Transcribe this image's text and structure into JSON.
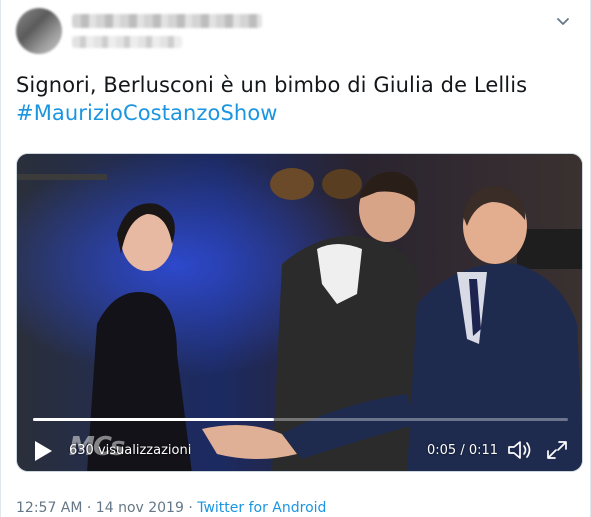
{
  "tweet": {
    "line1": "Signori, Berlusconi è un bimbo di Giulia de Lellis",
    "hashtag": "#MaurizioCostanzoShow"
  },
  "video": {
    "views_label": "630 visualizzazioni",
    "time_label": "0:05 / 0:11",
    "progress": 0.45,
    "watermark_text": "MCs"
  },
  "footer": {
    "timestamp": "12:57 AM · 14 nov 2019",
    "separator": " · ",
    "source": "Twitter for Android"
  },
  "colors": {
    "accent": "#1b95e0",
    "text": "#14171a",
    "muted": "#657786"
  },
  "icons": {
    "menu": "chevron-down-icon",
    "play": "play-icon",
    "volume": "volume-icon",
    "fullscreen": "fullscreen-icon"
  }
}
